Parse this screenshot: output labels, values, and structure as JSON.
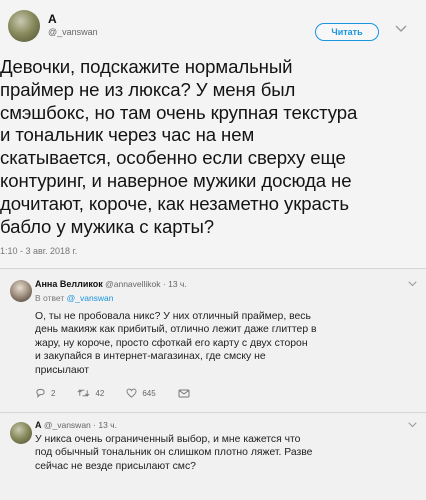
{
  "main_tweet": {
    "display_name": "А",
    "handle": "@_vanswan",
    "follow_label": "Читать",
    "text_lines": [
      "Девочки, подскажите нормальный",
      "праймер не из люкса? У меня был",
      "смэшбокс,  но там очень крупная текстура",
      "и тональник через час на нем",
      "скатывается,  особенно если сверху еще",
      "контуринг, и наверное мужики досюда не",
      "дочитают, короче, как незаметно украсть",
      "бабло у мужика с карты?"
    ],
    "timestamp": "1:10 - 3 авг. 2018 г."
  },
  "replies": [
    {
      "display_name": "Анна Велликок",
      "handle": "@annavellikok",
      "time": "· 13 ч.",
      "in_reply_prefix": "В ответ",
      "in_reply_handle": "@_vanswan",
      "text_lines": [
        "О, ты не пробовала никс? У них отличный праймер, весь",
        "день макияж как прибитый, отлично лежит даже глиттер в",
        "жару, ну короче, просто сфоткай его карту с двух сторон",
        "и закупайся в интернет-магазинах, где смску не",
        "присылают"
      ],
      "actions": {
        "replies": "2",
        "retweets": "42",
        "likes": "645"
      }
    },
    {
      "display_name": "А",
      "handle": "@_vanswan",
      "time": "· 13 ч.",
      "text_lines": [
        "У никса очень ограниченный выбор, и мне кажется что",
        "под обычный тональник он слишком плотно ляжет. Разве",
        "сейчас не везде присылают смс?"
      ]
    }
  ],
  "colors": {
    "accent": "#1b95e0",
    "like": "#e0245e"
  }
}
